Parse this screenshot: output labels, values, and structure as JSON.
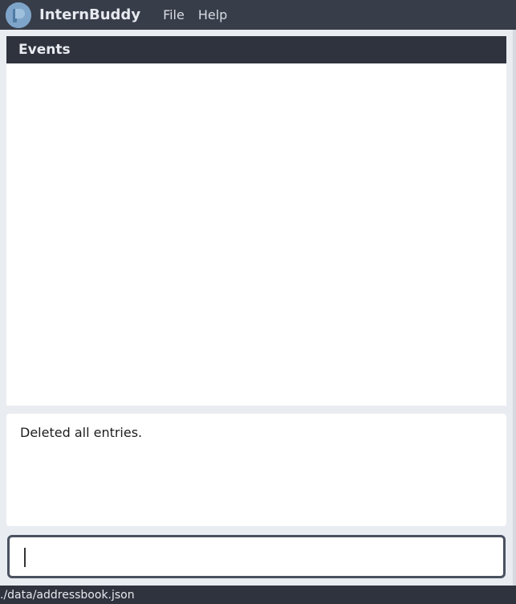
{
  "app": {
    "title": "InternBuddy",
    "logo_icon": "internbuddy-logo-icon"
  },
  "menu": {
    "items": [
      {
        "label": "File"
      },
      {
        "label": "Help"
      }
    ]
  },
  "events_panel": {
    "title": "Events"
  },
  "result": {
    "text": "Deleted all entries."
  },
  "command": {
    "value": ""
  },
  "status_bar": {
    "path": "./data/addressbook.json"
  },
  "colors": {
    "menubar": "#383d4a",
    "header": "#2f333d",
    "background": "#e9ecf1"
  }
}
